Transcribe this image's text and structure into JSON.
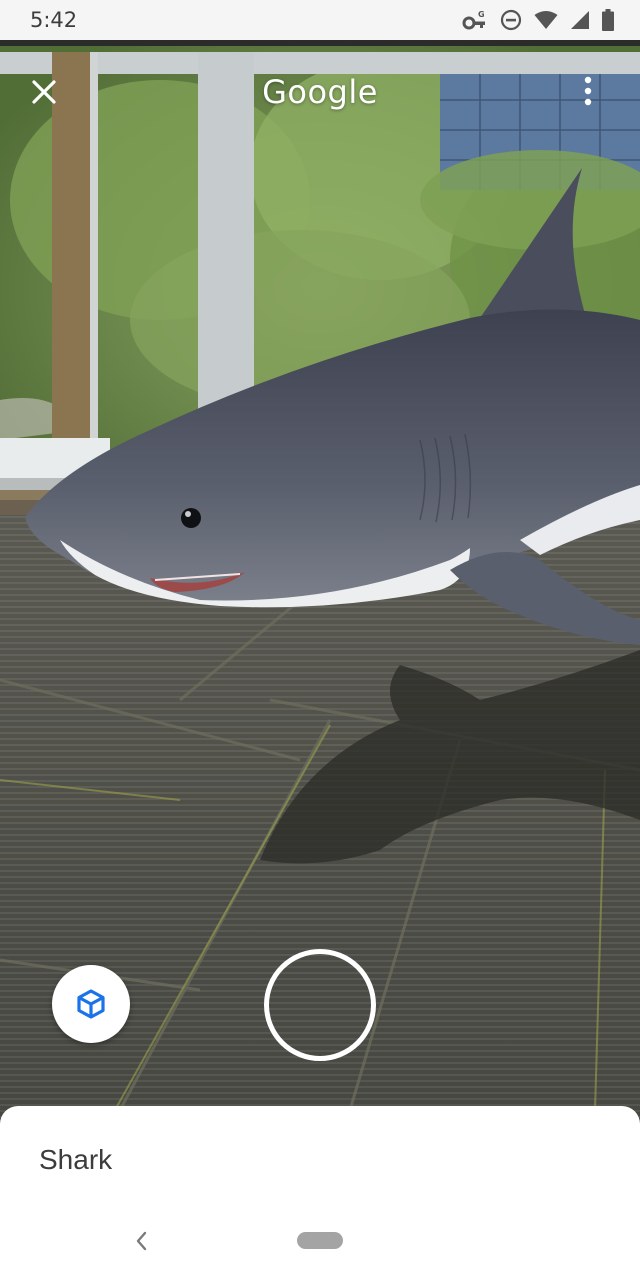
{
  "status_bar": {
    "time": "5:42",
    "icons": [
      "vpn-key-icon",
      "do-not-disturb-icon",
      "wifi-icon",
      "cell-signal-icon",
      "battery-icon"
    ]
  },
  "top_bar": {
    "logo_text": "Google",
    "close_icon": "close-icon",
    "menu_icon": "more-vert-icon"
  },
  "controls": {
    "view_3d_icon": "cube-icon",
    "accent_color": "#1a73e8"
  },
  "bottom_sheet": {
    "title": "Shark"
  },
  "navigation": {
    "back_icon": "chevron-left-icon",
    "home_icon": "home-pill-icon"
  }
}
